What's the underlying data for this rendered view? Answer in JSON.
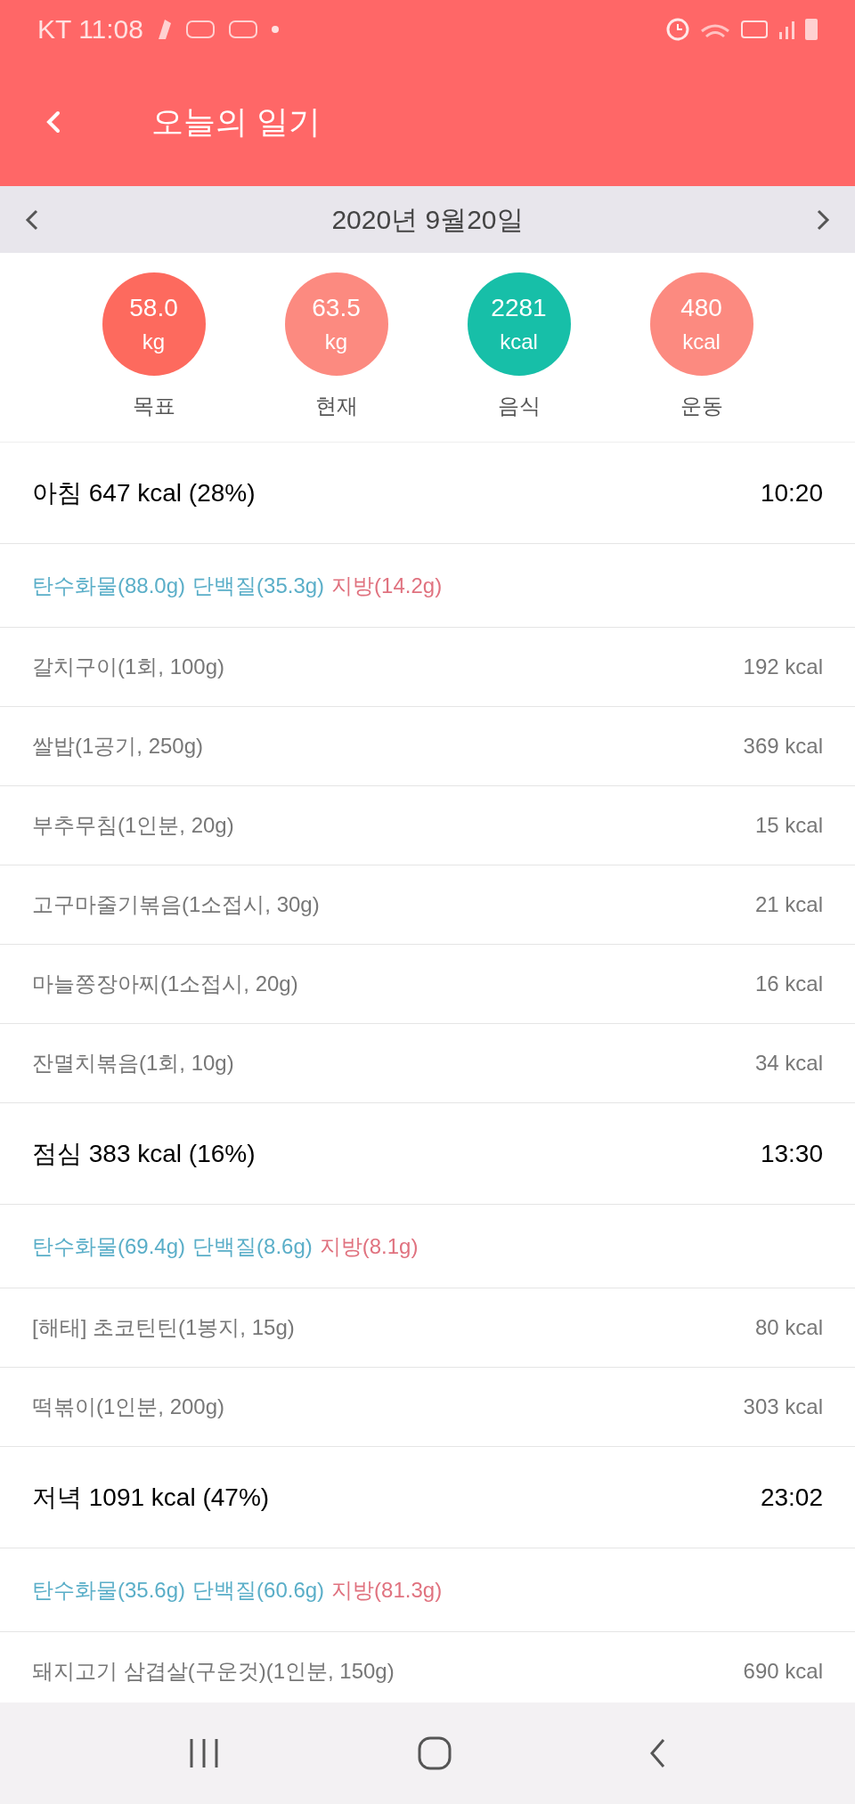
{
  "status_bar": {
    "carrier_time": "KT 11:08"
  },
  "header": {
    "title": "오늘의 일기"
  },
  "date_bar": {
    "date": "2020년 9월20일"
  },
  "summary": [
    {
      "value": "58.0",
      "unit": "kg",
      "label": "목표",
      "color": "#fd6a5e"
    },
    {
      "value": "63.5",
      "unit": "kg",
      "label": "현재",
      "color": "#fc8a80"
    },
    {
      "value": "2281",
      "unit": "kcal",
      "label": "음식",
      "color": "#17bfa8"
    },
    {
      "value": "480",
      "unit": "kcal",
      "label": "운동",
      "color": "#fc8a80"
    }
  ],
  "meals": [
    {
      "title": "아침 647 kcal (28%)",
      "time": "10:20",
      "macros": [
        "탄수화물(88.0g)",
        "단백질(35.3g)",
        "지방(14.2g)"
      ],
      "foods": [
        {
          "name": "갈치구이(1회, 100g)",
          "kcal": "192 kcal"
        },
        {
          "name": "쌀밥(1공기, 250g)",
          "kcal": "369 kcal"
        },
        {
          "name": "부추무침(1인분, 20g)",
          "kcal": "15 kcal"
        },
        {
          "name": "고구마줄기볶음(1소접시, 30g)",
          "kcal": "21 kcal"
        },
        {
          "name": "마늘쫑장아찌(1소접시, 20g)",
          "kcal": "16 kcal"
        },
        {
          "name": "잔멸치볶음(1회, 10g)",
          "kcal": "34 kcal"
        }
      ]
    },
    {
      "title": "점심 383 kcal (16%)",
      "time": "13:30",
      "macros": [
        "탄수화물(69.4g)",
        "단백질(8.6g)",
        "지방(8.1g)"
      ],
      "foods": [
        {
          "name": "[해태] 초코틴틴(1봉지, 15g)",
          "kcal": "80 kcal"
        },
        {
          "name": "떡볶이(1인분, 200g)",
          "kcal": "303 kcal"
        }
      ]
    },
    {
      "title": "저녁 1091 kcal (47%)",
      "time": "23:02",
      "macros": [
        "탄수화물(35.6g)",
        "단백질(60.6g)",
        "지방(81.3g)"
      ],
      "foods": [
        {
          "name": "돼지고기 삼겹살(구운것)(1인분, 150g)",
          "kcal": "690 kcal"
        }
      ]
    }
  ]
}
